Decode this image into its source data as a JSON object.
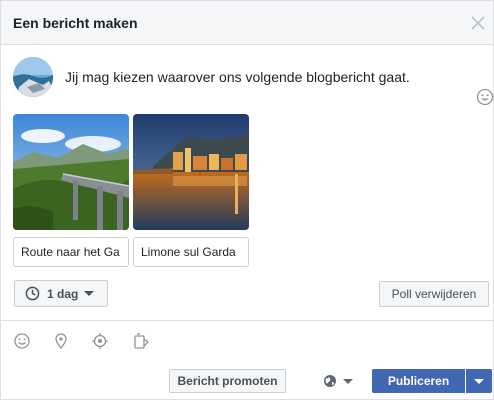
{
  "dialog": {
    "title": "Een bericht maken"
  },
  "composer": {
    "prompt": "Jij mag kiezen waarover ons volgende blogbericht gaat."
  },
  "poll": {
    "options": [
      {
        "label": "Route naar het Ga"
      },
      {
        "label": "Limone sul Garda"
      }
    ],
    "duration": "1 dag",
    "remove_label": "Poll verwijderen"
  },
  "footer": {
    "promote_label": "Bericht promoten",
    "publish_label": "Publiceren"
  },
  "colors": {
    "accent": "#4267b2",
    "header_bg": "#f5f6f7",
    "border": "#dddfe2"
  },
  "icons": [
    "close-icon",
    "emoji-icon",
    "clock-icon",
    "smiley-icon",
    "location-pin-icon",
    "target-icon",
    "tag-icon",
    "globe-icon"
  ]
}
